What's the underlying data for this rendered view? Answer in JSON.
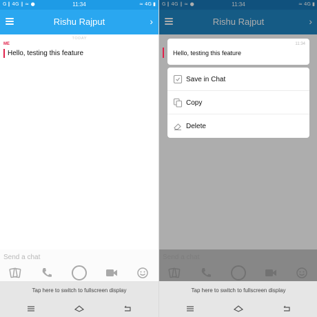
{
  "status": {
    "left": "G ∥ 4G ∥ ≈ ●",
    "time": "11:34",
    "right": "≈ 4G ▮"
  },
  "header": {
    "title": "Rishu Rajput"
  },
  "chat": {
    "date_divider": "TODAY",
    "sender": "ME",
    "message": "Hello, testing this feature"
  },
  "input": {
    "placeholder": "Send a chat"
  },
  "fullscreen_hint": "Tap here to switch to fullscreen display",
  "preview": {
    "message": "Hello, testing this feature",
    "time": "11:34"
  },
  "context_menu": {
    "items": [
      {
        "label": "Save in Chat",
        "icon": "save-in-chat-icon"
      },
      {
        "label": "Copy",
        "icon": "copy-icon"
      },
      {
        "label": "Delete",
        "icon": "eraser-icon"
      }
    ]
  },
  "colors": {
    "header": "#2aa7f0",
    "accent": "#e0214a"
  }
}
